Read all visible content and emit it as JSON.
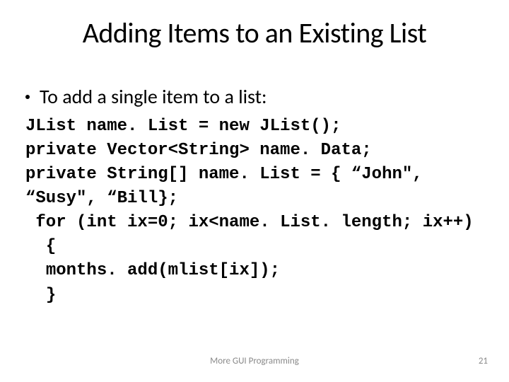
{
  "title": "Adding Items to an Existing List",
  "bullet": "To add a single item to a list:",
  "code": {
    "l1": "JList name. List = new JList();",
    "l2": "private Vector<String> name. Data;",
    "l3": "private String[] name. List = { “John\", “Susy\", “Bill};",
    "l4": " for (int ix=0; ix<name. List. length; ix++)",
    "l5": "  {",
    "l6": "  months. add(mlist[ix]);",
    "l7": "  }"
  },
  "footer": {
    "center": "More GUI Programming",
    "page": "21"
  }
}
